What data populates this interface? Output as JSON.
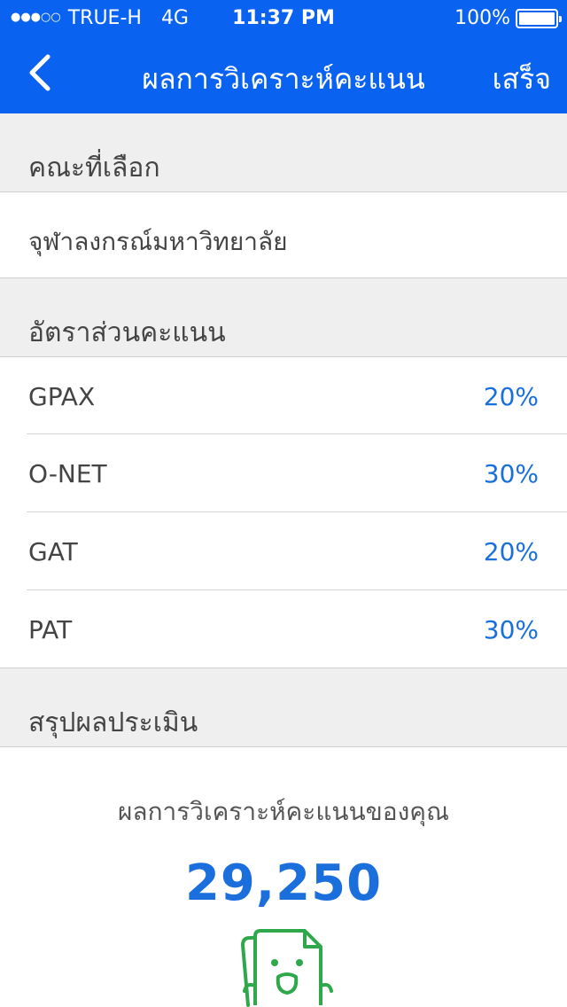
{
  "status_bar": {
    "signal": "●●●○○",
    "carrier": "TRUE-H",
    "network": "4G",
    "time": "11:37 PM",
    "battery": "100%"
  },
  "nav": {
    "title": "ผลการวิเคราะห์คะแนน",
    "done_label": "เสร็จ",
    "back_icon": "chevron-left-icon"
  },
  "faculty": {
    "header": "คณะที่เลือก",
    "name": "จุฬาลงกรณ์มหาวิทยาลัย"
  },
  "ratio": {
    "header": "อัตราส่วนคะแนน",
    "items": [
      {
        "label": "GPAX",
        "value": "20%"
      },
      {
        "label": "O-NET",
        "value": "30%"
      },
      {
        "label": "GAT",
        "value": "20%"
      },
      {
        "label": "PAT",
        "value": "30%"
      }
    ]
  },
  "summary": {
    "header": "สรุปผลประเมิน",
    "result_label": "ผลการวิเคราะห์คะแนนของคุณ",
    "score": "29,250",
    "mascot_icon": "document-mascot-icon"
  },
  "colors": {
    "brand_blue": "#0a63f0",
    "value_blue": "#1b6fdc",
    "mascot_green": "#2ea84a"
  }
}
